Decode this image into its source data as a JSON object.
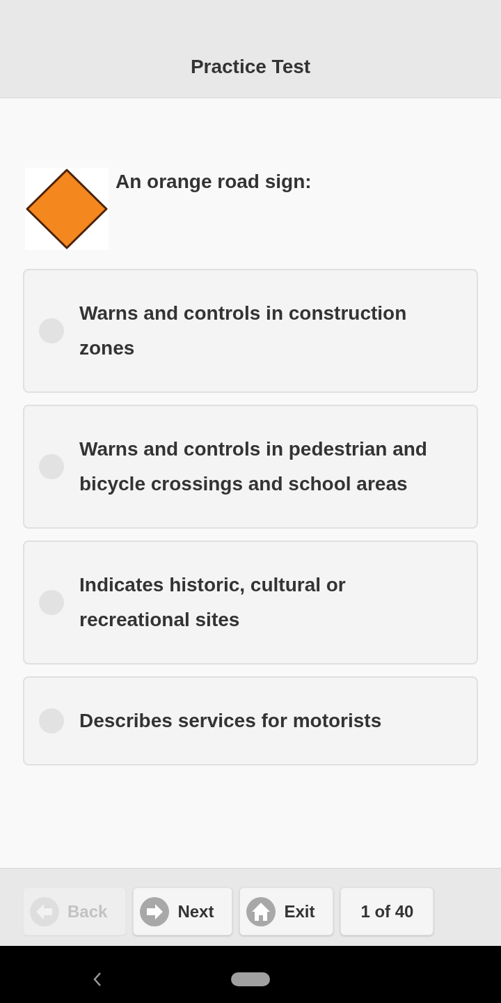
{
  "header": {
    "title": "Practice Test"
  },
  "question": {
    "text": "An orange road sign:"
  },
  "answers": [
    {
      "text": "Warns and controls in construction zones",
      "selected": false
    },
    {
      "text": "Warns and controls in pedestrian and bicycle crossings and school areas",
      "selected": false
    },
    {
      "text": "Indicates historic, cultural or recreational sites",
      "selected": false
    },
    {
      "text": "Describes services for motorists",
      "selected": false
    }
  ],
  "footer": {
    "buttons": [
      {
        "kind": "back",
        "label": "Back",
        "disabled": true
      },
      {
        "kind": "next",
        "label": "Next",
        "disabled": false
      },
      {
        "kind": "exit",
        "label": "Exit",
        "disabled": false
      },
      {
        "kind": "counter",
        "label": "1 of 40",
        "disabled": false
      }
    ]
  }
}
